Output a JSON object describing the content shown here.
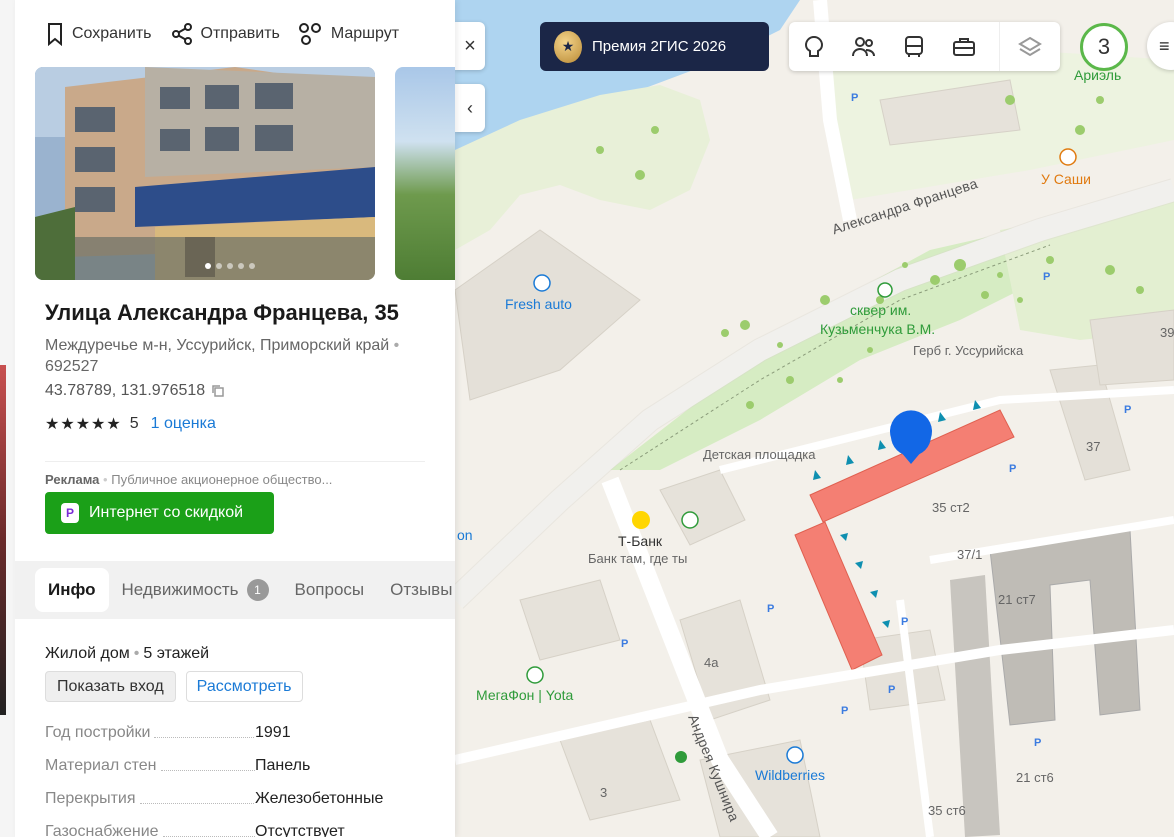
{
  "card": {
    "actions": {
      "save": "Сохранить",
      "share": "Отправить",
      "route": "Маршрут"
    },
    "title": "Улица Александра Францева, 35",
    "address": "Междуречье м-н, Уссурийск, Приморский край",
    "postal_code": "692527",
    "coords": "43.78789, 131.976518",
    "rating": {
      "stars": "★★★★★",
      "value": "5",
      "count": "1 оценка"
    },
    "ad": {
      "label": "Реклама",
      "text": "Публичное акционерное общество..."
    },
    "promo_button": "Интернет со скидкой",
    "tabs": [
      {
        "label": "Инфо"
      },
      {
        "label": "Недвижимость",
        "badge": "1"
      },
      {
        "label": "Вопросы"
      },
      {
        "label": "Отзывы"
      }
    ],
    "info": {
      "type": "Жилой дом",
      "floors": "5 этажей",
      "show_entrance": "Показать вход",
      "view": "Рассмотреть",
      "properties": [
        {
          "key": "Год постройки",
          "value": "1991"
        },
        {
          "key": "Материал стен",
          "value": "Панель"
        },
        {
          "key": "Перекрытия",
          "value": "Железобетонные"
        },
        {
          "key": "Газоснабжение",
          "value": "Отсутствует"
        }
      ]
    }
  },
  "toolbar": {
    "close": "×",
    "collapse": "‹",
    "premium": "Премия 2ГИС 2026",
    "weather_value": "3",
    "weather_label": "Ариэль"
  },
  "map": {
    "labels": {
      "street_francev": "Александра Францева",
      "street_kushnira": "Андрея Кушнира",
      "fresh_auto": "Fresh auto",
      "park": "сквер им.",
      "park2": "Кузьменчука В.М.",
      "coat": "Герб г. Уссурийска",
      "playground": "Детская площадка",
      "tbank": "Т-Банк",
      "tbank_sub": "Банк там, где ты",
      "megafon": "МегаФон | Yota",
      "wildberries": "Wildberries",
      "u_sashi": "У Саши",
      "on": "on",
      "b35st2": "35 ст2",
      "b37_1": "37/1",
      "b37": "37",
      "b39": "39",
      "b21st7": "21 ст7",
      "b4a": "4а",
      "b21st6": "21 ст6",
      "b35st6": "35 ст6",
      "b3": "3",
      "parking": "P"
    }
  }
}
